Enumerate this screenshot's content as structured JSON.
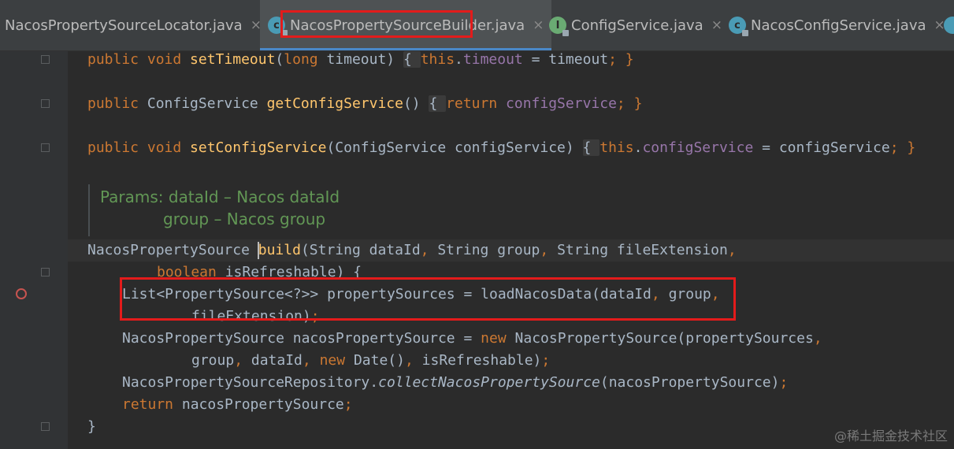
{
  "tabs": [
    {
      "label": "NacosPropertySourceLocator.java",
      "icon": "none",
      "icon_color": ""
    },
    {
      "label": "NacosPropertySourceBuilder.java",
      "icon": "class-lock-icon",
      "icon_letter": "c",
      "icon_color": "#4a9bb5",
      "active": true
    },
    {
      "label": "ConfigService.java",
      "icon": "interface-lock-icon",
      "icon_letter": "I",
      "icon_color": "#6aab73"
    },
    {
      "label": "NacosConfigService.java",
      "icon": "class-lock-icon",
      "icon_letter": "c",
      "icon_color": "#4a9bb5"
    }
  ],
  "tab_close": "×",
  "code": {
    "l1": {
      "a": "public void ",
      "b": "setTimeout",
      "c": "(",
      "d": "long ",
      "e": "timeout) ",
      "f": "{ ",
      "g": "this",
      "h": ".",
      "i": "timeout",
      "j": " = timeout",
      "k": "; }"
    },
    "l2": {
      "a": "public ",
      "b": "ConfigService ",
      "c": "getConfigService",
      "d": "() ",
      "e": "{ ",
      "f": "return ",
      "g": "configService",
      "h": "; }"
    },
    "l3": {
      "a": "public void ",
      "b": "setConfigService",
      "c": "(ConfigService configService) ",
      "d": "{ ",
      "e": "this",
      "f": ".",
      "g": "configService",
      "h": " = configService",
      "i": "; }"
    },
    "doc1": "Params: dataId – Nacos dataId",
    "doc2": "group – Nacos group",
    "l4": {
      "a": "NacosPropertySource ",
      "b": "build",
      "c": "(String dataId",
      ", ": ", ",
      "d": "String group",
      ", 2": ", ",
      "e": "String fileExtension",
      ",3": ","
    },
    "l5": {
      "a": "boolean ",
      "b": "isRefreshable) {"
    },
    "l6": {
      "a": "List<PropertySource<?>> propertySources = loadNacosData(dataId",
      ",": ", ",
      "b": "group",
      ",2": ","
    },
    "l7": {
      "a": "fileExtension)",
      ";": ";"
    },
    "l8": {
      "a": "NacosPropertySource nacosPropertySource = ",
      "b": "new ",
      "c": "NacosPropertySource(propertySources",
      ",": ","
    },
    "l9": {
      "a": "group",
      ",": ", ",
      "b": "dataId",
      ",2": ", ",
      "c": "new ",
      "d": "Date()",
      ",3": ", ",
      "e": "isRefreshable)",
      ";": ";"
    },
    "l10": {
      "a": "NacosPropertySourceRepository.",
      "b": "collectNacosPropertySource",
      "c": "(nacosPropertySource)",
      ";": ";"
    },
    "l11": {
      "a": "return ",
      "b": "nacosPropertySource",
      ";": ";"
    },
    "l12": "}"
  },
  "watermark": "@稀土掘金技术社区"
}
